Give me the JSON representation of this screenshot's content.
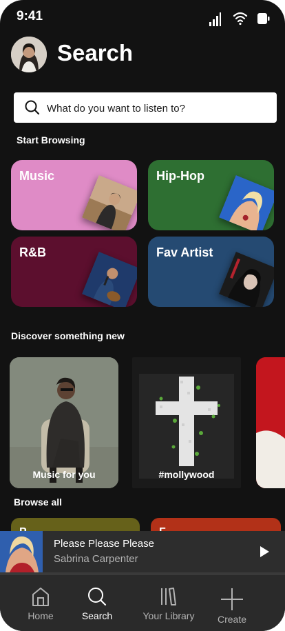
{
  "status_bar": {
    "time": "9:41"
  },
  "header": {
    "title": "Search"
  },
  "search": {
    "placeholder": "What do you want to listen to?"
  },
  "start_browsing": {
    "label": "Start Browsing",
    "tiles": [
      {
        "label": "Music",
        "color": "#df8bc6"
      },
      {
        "label": "Hip-Hop",
        "color": "#2e6f32"
      },
      {
        "label": "R&B",
        "color": "#5c0f2e"
      },
      {
        "label": "Fav Artist",
        "color": "#254a72"
      }
    ]
  },
  "discover": {
    "label": "Discover something new",
    "cards": [
      {
        "label": "Music for you"
      },
      {
        "label": "#mollywood"
      }
    ]
  },
  "browse_all": {
    "label": "Browse all",
    "cards": [
      {
        "label": "P",
        "color": "#66611a"
      },
      {
        "label": "F",
        "color": "#b23118"
      }
    ]
  },
  "now_playing": {
    "song": "Please Please Please",
    "artist": "Sabrina Carpenter"
  },
  "tabs": [
    {
      "label": "Home",
      "icon": "home-icon",
      "active": false
    },
    {
      "label": "Search",
      "icon": "search-icon",
      "active": true
    },
    {
      "label": "Your Library",
      "icon": "library-icon",
      "active": false
    },
    {
      "label": "Create",
      "icon": "plus-icon",
      "active": false
    }
  ],
  "colors": {
    "background": "#121212",
    "tabbar": "#2a2a2a",
    "player": "#2d2d2d"
  }
}
